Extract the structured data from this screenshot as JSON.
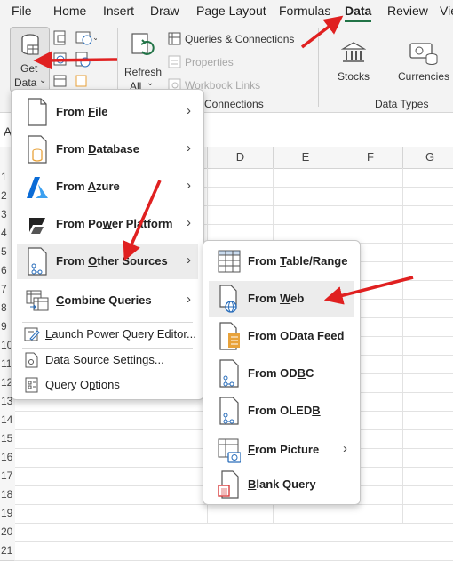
{
  "tabs": [
    "File",
    "Home",
    "Insert",
    "Draw",
    "Page Layout",
    "Formulas",
    "Data",
    "Review",
    "Vie"
  ],
  "active_tab": "Data",
  "ribbon": {
    "get_data_line1": "Get",
    "get_data_line2": "Data",
    "refresh_line1": "Refresh",
    "refresh_line2": "All",
    "queries_connections": "Queries & Connections",
    "properties": "Properties",
    "workbook_links": "Workbook Links",
    "group_connections": "Connections",
    "stocks": "Stocks",
    "currencies": "Currencies",
    "group_data_types": "Data Types"
  },
  "sheet": {
    "name_box_fragment": "A",
    "columns": [
      "D",
      "E",
      "F",
      "G"
    ],
    "rows": [
      "1",
      "2",
      "3",
      "4",
      "5",
      "6",
      "7",
      "8",
      "9",
      "10",
      "11",
      "12",
      "13",
      "14",
      "15",
      "16",
      "17",
      "18",
      "19",
      "20",
      "21"
    ]
  },
  "get_data_menu": {
    "items": [
      {
        "pre": "From ",
        "key": "F",
        "post": "ile"
      },
      {
        "pre": "From ",
        "key": "D",
        "post": "atabase"
      },
      {
        "pre": "From ",
        "key": "A",
        "post": "zure"
      },
      {
        "pre": "From Po",
        "key": "w",
        "post": "er Platform"
      },
      {
        "pre": "From ",
        "key": "O",
        "post": "ther Sources"
      },
      {
        "pre": "",
        "key": "C",
        "post": "ombine Queries"
      }
    ],
    "launch_editor": {
      "pre": "",
      "key": "L",
      "post": "aunch Power Query Editor..."
    },
    "data_source_settings": {
      "pre": "Data ",
      "key": "S",
      "post": "ource Settings..."
    },
    "query_options": {
      "pre": "Query O",
      "key": "p",
      "post": "tions"
    }
  },
  "other_sources_menu": {
    "items": [
      {
        "pre": "From ",
        "key": "T",
        "post": "able/Range"
      },
      {
        "pre": "From ",
        "key": "W",
        "post": "eb"
      },
      {
        "pre": "From ",
        "key": "O",
        "post": "Data Feed"
      },
      {
        "pre": "From OD",
        "key": "B",
        "post": "C"
      },
      {
        "pre": "From OLED",
        "key": "B",
        "post": ""
      },
      {
        "pre": "",
        "key": "F",
        "post": "rom Picture"
      },
      {
        "pre": "",
        "key": "B",
        "post": "lank Query"
      }
    ]
  },
  "colors": {
    "accent": "#217346",
    "arrow": "#e02020",
    "azure": "#0a6bd6",
    "db": "#e8a23a"
  }
}
